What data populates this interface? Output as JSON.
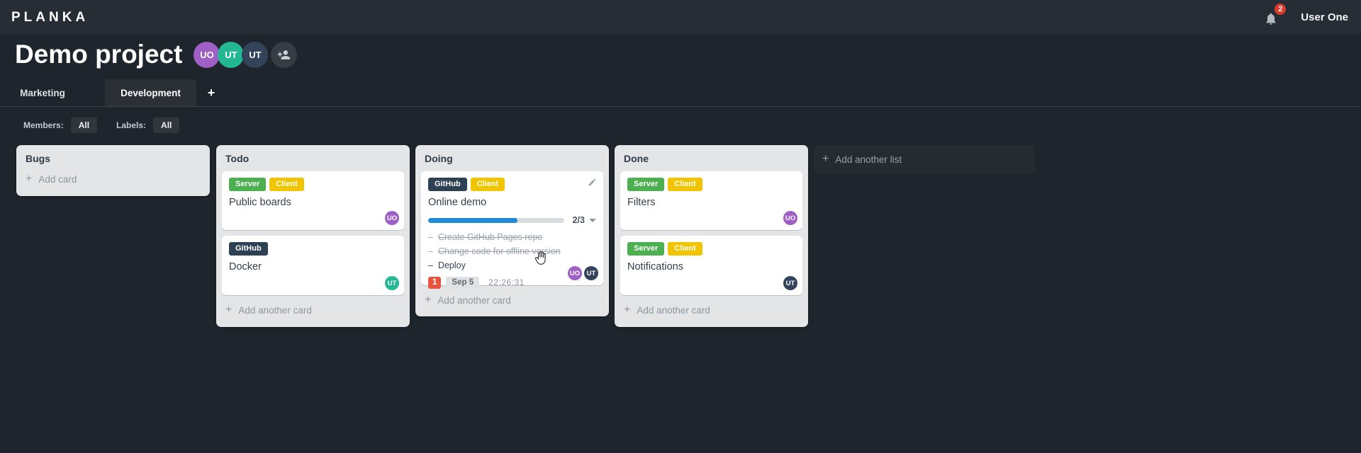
{
  "app": {
    "logo": "PLANKA",
    "user": "User One",
    "notification_count": "2"
  },
  "glyphs": {
    "plus": "+",
    "bullet": "–"
  },
  "project": {
    "title": "Demo project",
    "members": [
      {
        "initials": "UO",
        "color": "#a05fc5"
      },
      {
        "initials": "UT",
        "color": "#23b893"
      },
      {
        "initials": "UT",
        "color": "#33435a"
      }
    ]
  },
  "tabs": {
    "items": [
      {
        "label": "Marketing",
        "active": false
      },
      {
        "label": "Development",
        "active": true
      }
    ]
  },
  "filterbar": {
    "members_label": "Members:",
    "members_value": "All",
    "labels_label": "Labels:",
    "labels_value": "All"
  },
  "board": {
    "add_list_label": "Add another list",
    "label_colors": {
      "server": "#4caf50",
      "client": "#f0c500",
      "github": "#2e4154"
    },
    "accent_colors": {
      "progress_blue": "#2189d5",
      "overdue_red": "#e8543f"
    },
    "lists": [
      {
        "name": "Bugs",
        "add_label": "Add card",
        "cards": []
      },
      {
        "name": "Todo",
        "add_label": "Add another card",
        "cards": [
          {
            "title": "Public boards",
            "labels": [
              {
                "text": "Server",
                "color": "#4caf50"
              },
              {
                "text": "Client",
                "color": "#f0c500"
              }
            ],
            "members": [
              {
                "initials": "UO",
                "color": "#a05fc5"
              }
            ]
          },
          {
            "title": "Docker",
            "labels": [
              {
                "text": "GitHub",
                "color": "#2e4154"
              }
            ],
            "members": [
              {
                "initials": "UT",
                "color": "#23b893"
              }
            ]
          }
        ]
      },
      {
        "name": "Doing",
        "add_label": "Add another card",
        "cards": [
          {
            "title": "Online demo",
            "labels": [
              {
                "text": "GitHub",
                "color": "#2e4154"
              },
              {
                "text": "Client",
                "color": "#f0c500"
              }
            ],
            "checklist": {
              "summary": "2/3",
              "completed": 2,
              "total": 3,
              "progress_width": "66%",
              "tasks": [
                {
                  "text": "Create GitHub Pages repo",
                  "done": true
                },
                {
                  "text": "Change code for offline version",
                  "done": true
                },
                {
                  "text": "Deploy",
                  "done": false
                }
              ]
            },
            "badges": {
              "count": "1",
              "due_date": "Sep 5",
              "timer": "22:26:31"
            },
            "members": [
              {
                "initials": "UO",
                "color": "#a05fc5"
              },
              {
                "initials": "UT",
                "color": "#33435a"
              }
            ]
          }
        ]
      },
      {
        "name": "Done",
        "add_label": "Add another card",
        "cards": [
          {
            "title": "Filters",
            "labels": [
              {
                "text": "Server",
                "color": "#4caf50"
              },
              {
                "text": "Client",
                "color": "#f0c500"
              }
            ],
            "members": [
              {
                "initials": "UO",
                "color": "#a05fc5"
              }
            ]
          },
          {
            "title": "Notifications",
            "labels": [
              {
                "text": "Server",
                "color": "#4caf50"
              },
              {
                "text": "Client",
                "color": "#f0c500"
              }
            ],
            "members": [
              {
                "initials": "UT",
                "color": "#33435a"
              }
            ]
          }
        ]
      }
    ]
  }
}
